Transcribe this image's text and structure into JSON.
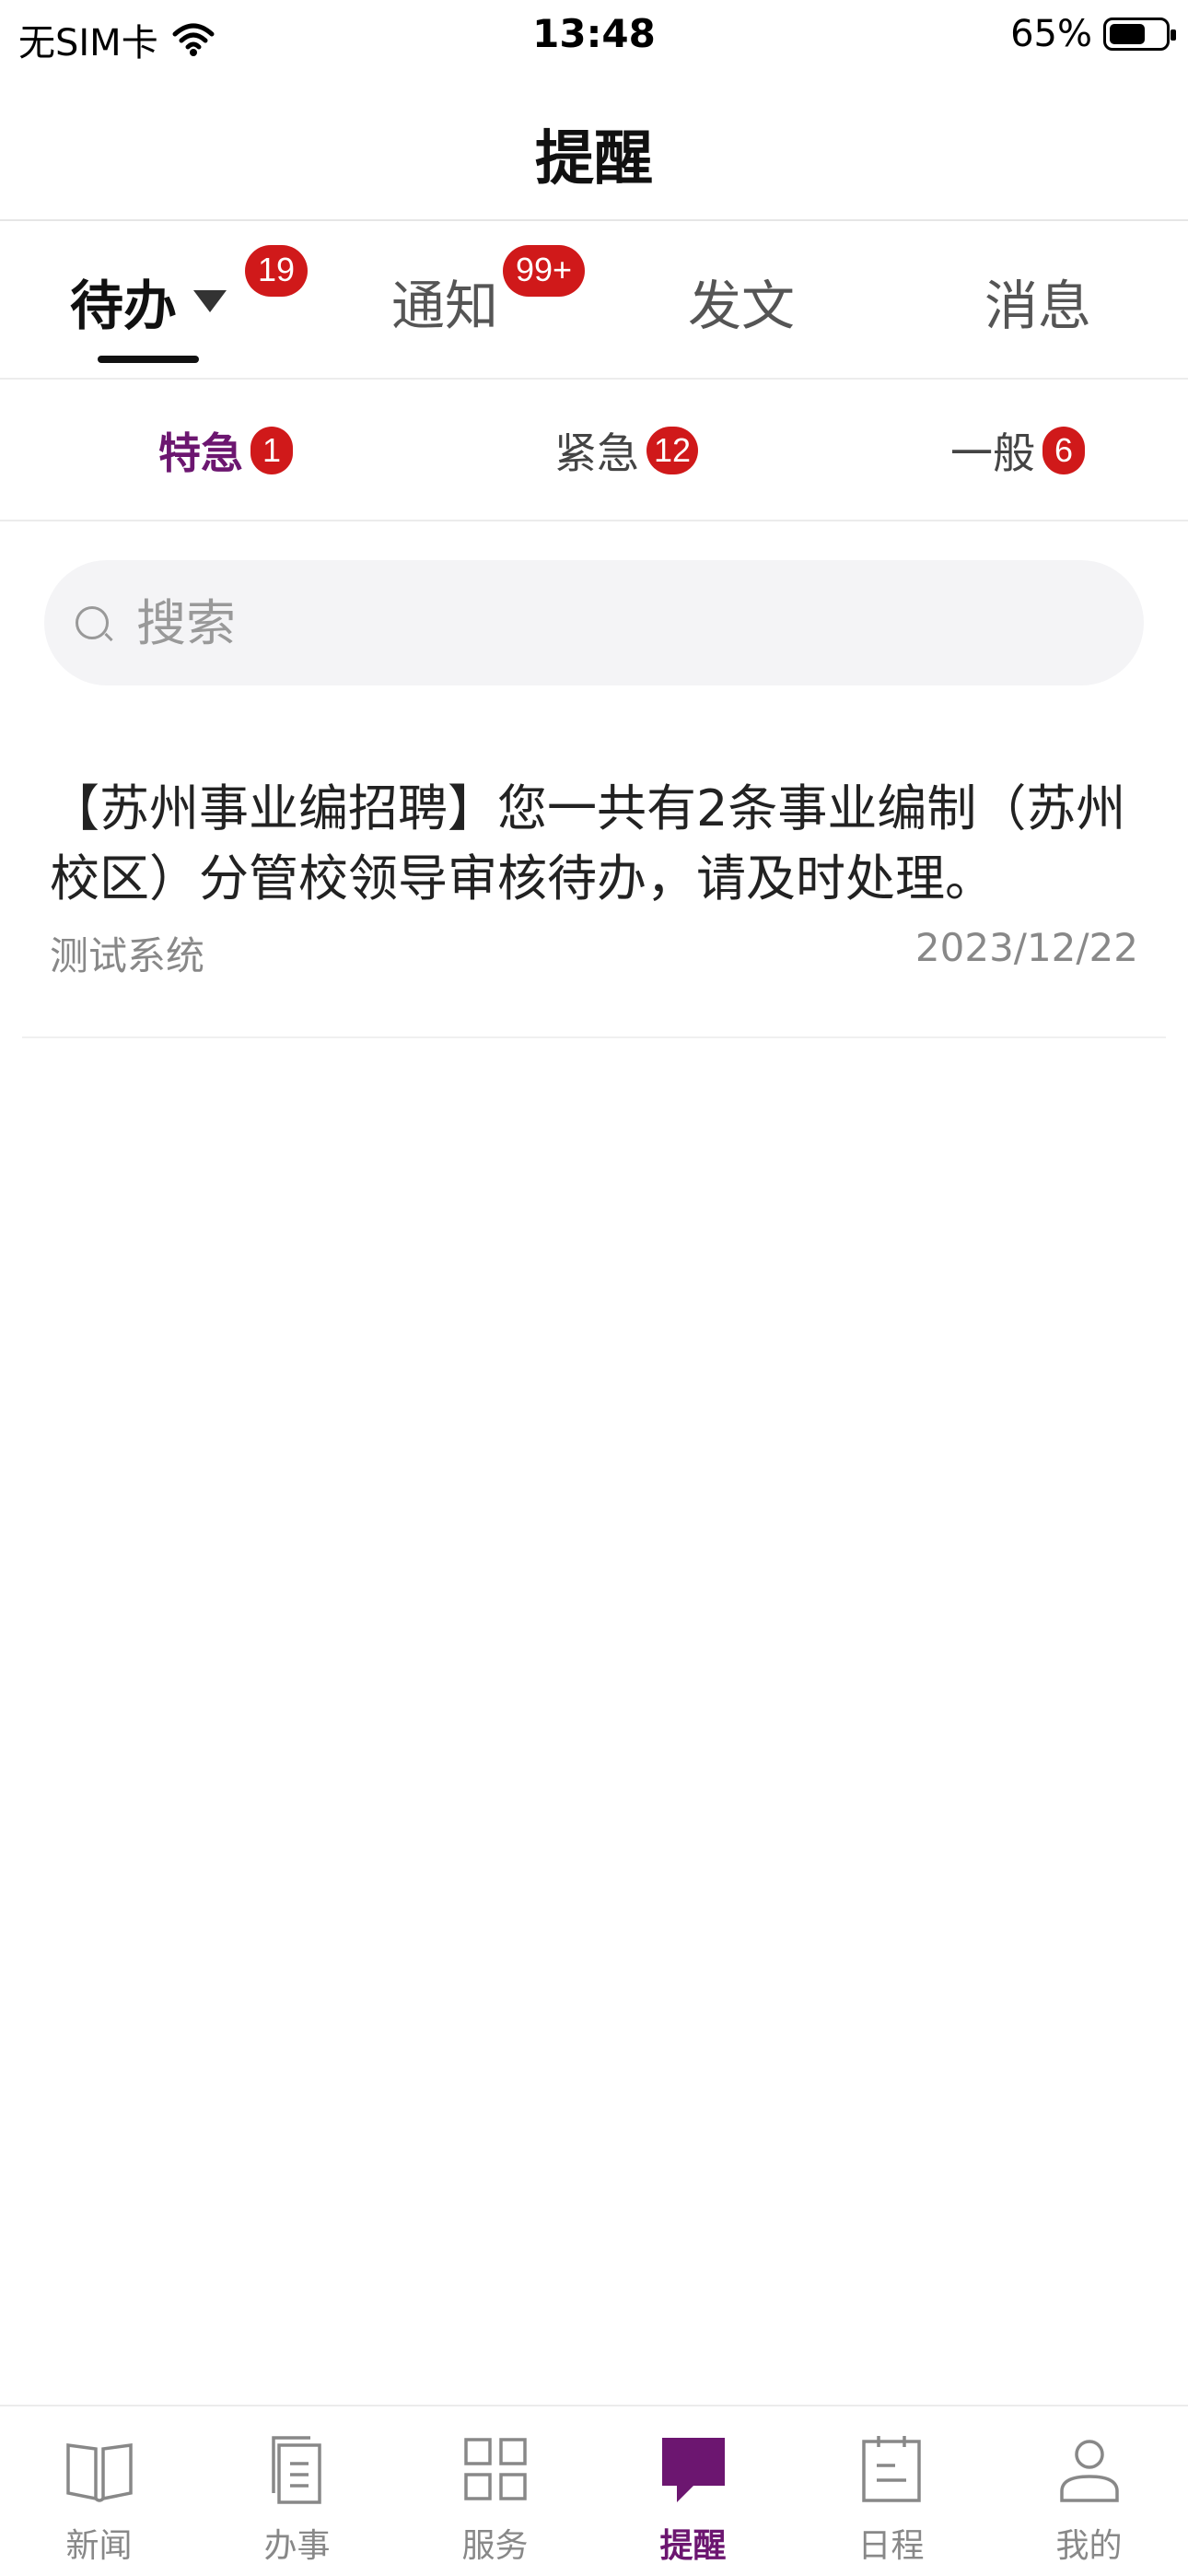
{
  "status": {
    "carrier": "无SIM卡",
    "time": "13:48",
    "battery_text": "65%",
    "battery_level": 0.65
  },
  "header": {
    "title": "提醒"
  },
  "tabs": [
    {
      "label": "待办",
      "badge": "19",
      "active": true
    },
    {
      "label": "通知",
      "badge": "99+",
      "active": false
    },
    {
      "label": "发文",
      "badge": "",
      "active": false
    },
    {
      "label": "消息",
      "badge": "",
      "active": false
    }
  ],
  "subtabs": [
    {
      "label": "特急",
      "badge": "1",
      "active": true
    },
    {
      "label": "紧急",
      "badge": "12",
      "active": false
    },
    {
      "label": "一般",
      "badge": "6",
      "active": false
    }
  ],
  "search": {
    "placeholder": "搜索",
    "value": ""
  },
  "items": [
    {
      "title": "【苏州事业编招聘】您一共有2条事业编制（苏州校区）分管校领导审核待办，请及时处理。",
      "source": "测试系统",
      "date": "2023/12/22"
    }
  ],
  "nav": [
    {
      "label": "新闻",
      "icon": "book-icon"
    },
    {
      "label": "办事",
      "icon": "document-icon"
    },
    {
      "label": "服务",
      "icon": "grid-icon"
    },
    {
      "label": "提醒",
      "icon": "chat-bubble-icon",
      "active": true
    },
    {
      "label": "日程",
      "icon": "calendar-icon"
    },
    {
      "label": "我的",
      "icon": "user-icon"
    }
  ],
  "colors": {
    "accent": "#6c1670",
    "badge": "#d0191a"
  }
}
